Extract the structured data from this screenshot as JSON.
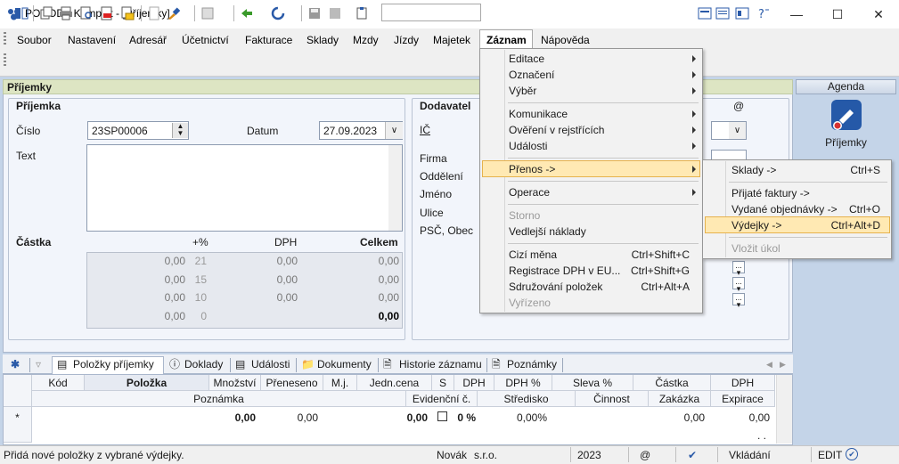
{
  "window": {
    "title": "POHODA Komplet - [Příjemky]"
  },
  "menubar": {
    "items": [
      "Soubor",
      "Nastavení",
      "Adresář",
      "Účetnictví",
      "Fakturace",
      "Sklady",
      "Mzdy",
      "Jízdy",
      "Majetek",
      "Záznam",
      "Nápověda"
    ]
  },
  "form": {
    "header": "Příjemky",
    "section_title": "Příjemka",
    "cislo_label": "Číslo",
    "cislo_value": "23SP00006",
    "datum_label": "Datum",
    "datum_value": "27.09.2023",
    "text_label": "Text",
    "castka_label": "Částka",
    "col_pct": "+%",
    "col_dph": "DPH",
    "col_celkem": "Celkem",
    "rows": [
      {
        "base": "0,00",
        "pct": "21",
        "dph": "0,00",
        "total": "0,00"
      },
      {
        "base": "0,00",
        "pct": "15",
        "dph": "0,00",
        "total": "0,00"
      },
      {
        "base": "0,00",
        "pct": "10",
        "dph": "0,00",
        "total": "0,00"
      },
      {
        "base": "0,00",
        "pct": "0",
        "dph": "",
        "total": "0,00"
      }
    ],
    "dodavatel_title": "Dodavatel",
    "ic_label": "IČ",
    "firma_label": "Firma",
    "oddeleni_label": "Oddělení",
    "jmeno_label": "Jméno",
    "ulice_label": "Ulice",
    "psc_label": "PSČ, Obec",
    "at_label": "@"
  },
  "agenda": {
    "title": "Agenda",
    "item": "Příjemky"
  },
  "tabs": [
    "Položky příjemky",
    "Doklady",
    "Události",
    "Dokumenty",
    "Historie záznamu",
    "Poznámky"
  ],
  "grid": {
    "headers1": [
      "Kód",
      "Položka",
      "Množství",
      "Přeneseno",
      "M.j.",
      "Jedn.cena",
      "S",
      "DPH",
      "DPH %",
      "Sleva %",
      "Částka",
      "DPH"
    ],
    "headers2": [
      "Poznámka",
      "Evidenční č.",
      "Středisko",
      "Činnost",
      "Zakázka",
      "Expirace"
    ],
    "row_marker": "*",
    "row": {
      "mnozstvi": "0,00",
      "preneseno": "0,00",
      "jedncena": "0,00",
      "dphpct": "0 %",
      "sleva": "0,00%",
      "castka": "0,00",
      "dph": "0,00"
    },
    "dots": ". ."
  },
  "statusbar": {
    "message": "Přidá nové položky z vybrané výdejky.",
    "user": "Novák",
    "company": "s.r.o.",
    "year": "2023",
    "at": "@",
    "mode": "Vkládání",
    "edit": "EDIT"
  },
  "menu_zaznam": [
    {
      "label": "Editace",
      "sub": true
    },
    {
      "label": "Označení",
      "sub": true
    },
    {
      "label": "Výběr",
      "sub": true
    },
    {
      "label": "Komunikace",
      "sub": true
    },
    {
      "label": "Ověření v rejstřících",
      "sub": true
    },
    {
      "label": "Události",
      "sub": true
    },
    {
      "label": "Přenos ->",
      "sub": true
    },
    {
      "label": "Operace",
      "sub": true
    },
    {
      "label": "Storno",
      "disabled": true
    },
    {
      "label": "Vedlejší náklady"
    },
    {
      "label": "Cizí měna",
      "shortcut": "Ctrl+Shift+C"
    },
    {
      "label": "Registrace DPH v EU...",
      "shortcut": "Ctrl+Shift+G"
    },
    {
      "label": "Sdružování položek",
      "shortcut": "Ctrl+Alt+A"
    },
    {
      "label": "Vyřízeno",
      "disabled": true
    }
  ],
  "menu_prenos": [
    {
      "label": "Sklady ->",
      "shortcut": "Ctrl+S"
    },
    {
      "label": "Přijaté faktury ->",
      "shortcut": ""
    },
    {
      "label": "Vydané objednávky ->",
      "shortcut": "Ctrl+O"
    },
    {
      "label": "Výdejky ->",
      "shortcut": "Ctrl+Alt+D"
    },
    {
      "label": "Vložit úkol",
      "disabled": true
    }
  ],
  "colors": {
    "highlight": "#ffe9b3",
    "formbg": "#c4d4e8",
    "header": "#dde5c3"
  }
}
